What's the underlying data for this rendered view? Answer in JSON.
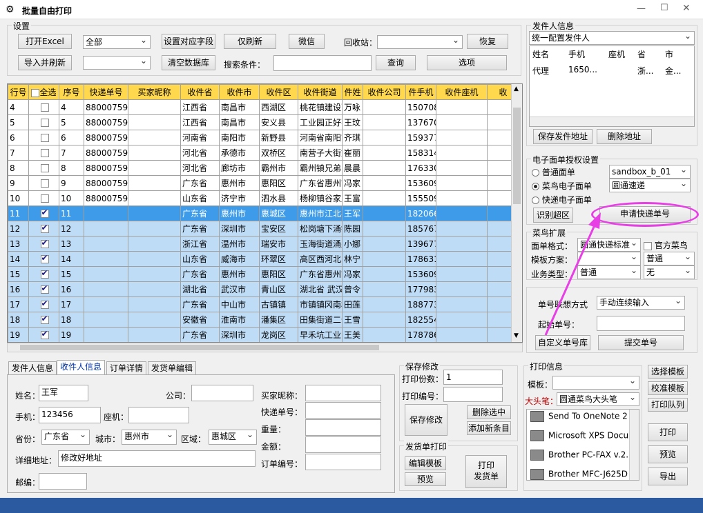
{
  "window": {
    "title": "批量自由打印",
    "min": "—",
    "max": "☐",
    "close": "✕"
  },
  "settings": {
    "group_title": "设置",
    "open_excel": "打开Excel",
    "import_refresh": "导入并刷新",
    "filter_value": "全部",
    "filter2_value": "",
    "set_fields": "设置对应字段",
    "clear_db": "清空数据库",
    "refresh_only": "仅刷新",
    "wechat": "微信",
    "recycle_label": "回收站：",
    "recycle_value": "",
    "restore": "恢复",
    "search_label": "搜索条件：",
    "search_value": "",
    "query": "查询",
    "options": "选项"
  },
  "grid": {
    "headers": [
      "行号",
      "全选",
      "序号",
      "快递单号",
      "买家昵称",
      "收件省",
      "收件市",
      "收件区",
      "收件街道",
      "件姓",
      "收件公司",
      "件手机",
      "收件座机",
      "收"
    ],
    "rows": [
      {
        "n": "4",
        "chk": false,
        "seq": "4",
        "tracking": "88000759€",
        "buyer": "",
        "prov": "江西省",
        "city": "南昌市",
        "dist": "西湖区",
        "street": "桃花镇建设西",
        "name": "万咏",
        "company": "",
        "phone": "150708",
        "tel": "",
        "state": "normal"
      },
      {
        "n": "5",
        "chk": false,
        "seq": "5",
        "tracking": "88000759€",
        "buyer": "",
        "prov": "江西省",
        "city": "南昌市",
        "dist": "安义县",
        "street": "工业园正好不",
        "name": "王玟",
        "company": "",
        "phone": "137670",
        "tel": "",
        "state": "normal"
      },
      {
        "n": "6",
        "chk": false,
        "seq": "6",
        "tracking": "88000759€",
        "buyer": "",
        "prov": "河南省",
        "city": "南阳市",
        "dist": "新野县",
        "street": "河南省南阳市",
        "name": "齐琪",
        "company": "",
        "phone": "159377",
        "tel": "",
        "state": "normal"
      },
      {
        "n": "7",
        "chk": false,
        "seq": "7",
        "tracking": "88000759€",
        "buyer": "",
        "prov": "河北省",
        "city": "承德市",
        "dist": "双桥区",
        "street": "南营子大街文",
        "name": "崔丽",
        "company": "",
        "phone": "158314",
        "tel": "",
        "state": "normal"
      },
      {
        "n": "8",
        "chk": false,
        "seq": "8",
        "tracking": "88000759€",
        "buyer": "",
        "prov": "河北省",
        "city": "廊坊市",
        "dist": "霸州市",
        "street": "霸州镇兄弟网",
        "name": "晨晨",
        "company": "",
        "phone": "176330",
        "tel": "",
        "state": "normal"
      },
      {
        "n": "9",
        "chk": false,
        "seq": "9",
        "tracking": "88000759€",
        "buyer": "",
        "prov": "广东省",
        "city": "惠州市",
        "dist": "惠阳区",
        "street": "广东省惠州市",
        "name": "冯家",
        "company": "",
        "phone": "153609",
        "tel": "",
        "state": "normal"
      },
      {
        "n": "10",
        "chk": false,
        "seq": "10",
        "tracking": "88000759€",
        "buyer": "",
        "prov": "山东省",
        "city": "济宁市",
        "dist": "泗水县",
        "street": "杨柳镇谷家庄",
        "name": "王富",
        "company": "",
        "phone": "155509",
        "tel": "",
        "state": "normal"
      },
      {
        "n": "11",
        "chk": true,
        "seq": "11",
        "tracking": "",
        "buyer": "",
        "prov": "广东省",
        "city": "惠州市",
        "dist": "惠城区",
        "street": "惠州市江北农",
        "name": "王军",
        "company": "",
        "phone": "182066",
        "tel": "",
        "state": "cur"
      },
      {
        "n": "12",
        "chk": true,
        "seq": "12",
        "tracking": "",
        "buyer": "",
        "prov": "广东省",
        "city": "深圳市",
        "dist": "宝安区",
        "street": "松岗塘下涌镒",
        "name": "陈园",
        "company": "",
        "phone": "185767",
        "tel": "",
        "state": "sel"
      },
      {
        "n": "13",
        "chk": true,
        "seq": "13",
        "tracking": "",
        "buyer": "",
        "prov": "浙江省",
        "city": "温州市",
        "dist": "瑞安市",
        "street": "玉海街道涌泉",
        "name": "小娜",
        "company": "",
        "phone": "139677",
        "tel": "",
        "state": "sel"
      },
      {
        "n": "14",
        "chk": true,
        "seq": "14",
        "tracking": "",
        "buyer": "",
        "prov": "山东省",
        "city": "威海市",
        "dist": "环翠区",
        "street": "高区西河北31",
        "name": "林宁",
        "company": "",
        "phone": "178631",
        "tel": "",
        "state": "sel"
      },
      {
        "n": "15",
        "chk": true,
        "seq": "15",
        "tracking": "",
        "buyer": "",
        "prov": "广东省",
        "city": "惠州市",
        "dist": "惠阳区",
        "street": "广东省惠州市",
        "name": "冯家",
        "company": "",
        "phone": "153609",
        "tel": "",
        "state": "sel"
      },
      {
        "n": "16",
        "chk": true,
        "seq": "16",
        "tracking": "",
        "buyer": "",
        "prov": "湖北省",
        "city": "武汉市",
        "dist": "青山区",
        "street": "湖北省 武汉",
        "name": "曾令",
        "company": "",
        "phone": "177983",
        "tel": "",
        "state": "sel"
      },
      {
        "n": "17",
        "chk": true,
        "seq": "17",
        "tracking": "",
        "buyer": "",
        "prov": "广东省",
        "city": "中山市",
        "dist": "古镇镇",
        "street": "市镇镇冈南村",
        "name": "田莲",
        "company": "",
        "phone": "188773",
        "tel": "",
        "state": "sel"
      },
      {
        "n": "18",
        "chk": true,
        "seq": "18",
        "tracking": "",
        "buyer": "",
        "prov": "安徽省",
        "city": "淮南市",
        "dist": "潘集区",
        "street": "田集街道二十",
        "name": "王雪",
        "company": "",
        "phone": "182554",
        "tel": "",
        "state": "sel"
      },
      {
        "n": "19",
        "chk": true,
        "seq": "19",
        "tracking": "",
        "buyer": "",
        "prov": "广东省",
        "city": "深圳市",
        "dist": "龙岗区",
        "street": "早禾坑工业区",
        "name": "王美",
        "company": "",
        "phone": "178786",
        "tel": "",
        "state": "sel"
      }
    ]
  },
  "sender": {
    "group_title": "发件人信息",
    "select_value": "统一配置发件人",
    "headers": [
      "姓名",
      "手机",
      "座机",
      "省",
      "市"
    ],
    "row": [
      "代理",
      "1650...",
      "",
      "浙...",
      "金..."
    ],
    "save": "保存发件地址",
    "delete": "删除地址"
  },
  "eform": {
    "group_title": "电子面单授权设置",
    "opt_normal": "普通面单",
    "opt_cainiao": "菜鸟电子面单",
    "opt_express": "快递电子面单",
    "account_value": "sandbox_b_01",
    "courier_value": "圆通速递",
    "identify": "识别超区",
    "apply": "申请快递单号"
  },
  "cainiao": {
    "group_title": "菜鸟扩展",
    "format_label": "面单格式：",
    "format_value": "圆通快递标准",
    "official": "官方菜鸟",
    "template_label": "模板方案：",
    "template_value": "",
    "template2_value": "普通",
    "biz_label": "业务类型：",
    "biz_value": "普通",
    "biz2_value": "无"
  },
  "tracking": {
    "mode_label": "单号联想方式",
    "mode_value": "手动连续输入",
    "start_label": "起始单号：",
    "start_value": "",
    "custom_lib": "自定义单号库",
    "submit": "提交单号"
  },
  "tabs": [
    "发件人信息",
    "收件人信息",
    "订单详情",
    "发货单编辑"
  ],
  "recipient": {
    "name_label": "姓名：",
    "name": "王军",
    "company_label": "公司：",
    "company": "",
    "buyer_label": "买家昵称：",
    "buyer": "",
    "phone_label": "手机：",
    "phone": "123456",
    "tel_label": "座机：",
    "tel": "",
    "tracking_label": "快递单号：",
    "tracking": "",
    "prov_label": "省份：",
    "prov": "广东省",
    "city_label": "城市：",
    "city": "惠州市",
    "dist_label": "区域：",
    "dist": "惠城区",
    "weight_label": "重量：",
    "weight": "",
    "addr_label": "详细地址：",
    "addr": "修改好地址",
    "amount_label": "金额：",
    "amount": "",
    "order_label": "订单编号：",
    "order": "",
    "zip_label": "邮编：",
    "zip": ""
  },
  "save_mod": {
    "group_title": "保存修改",
    "copies_label": "打印份数：",
    "copies": "1",
    "code_label": "打印编号：",
    "code": "",
    "save": "保存修改",
    "delete_sel": "删除选中",
    "add_new": "添加新条目"
  },
  "ship_print": {
    "group_title": "发货单打印",
    "edit_tpl": "编辑模板",
    "preview": "预览",
    "print": "打印\n发货单"
  },
  "print_info": {
    "group_title": "打印信息",
    "tpl_label": "模板：",
    "tpl_value": "",
    "big_label": "大头笔：",
    "big_value": "圆通菜鸟大头笔",
    "printers": [
      "Send To OneNote 2",
      "Microsoft XPS Docu",
      "Brother PC-FAX v.2.2",
      "Brother MFC-J625D"
    ],
    "choose_tpl": "选择模板",
    "calibrate": "校准模板",
    "queue": "打印队列",
    "print": "打印",
    "preview": "预览",
    "export": "导出"
  },
  "colors": {
    "header_yellow": "#ffd84d",
    "current_row": "#3d9be9",
    "selected_row": "#bfdcf7",
    "annotation": "#e83ee6",
    "status_bar": "#2b5aa0"
  }
}
